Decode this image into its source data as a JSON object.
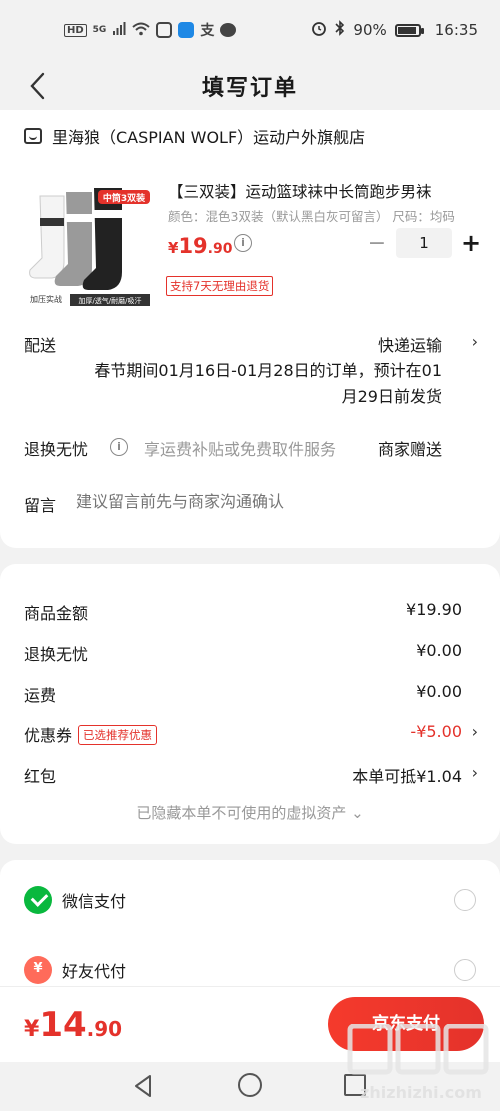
{
  "status_bar": {
    "left_icons": [
      "HD",
      "5G",
      "signal-icon",
      "wifi-icon",
      "app-icon",
      "app-icon",
      "alipay-icon",
      "chat-icon"
    ],
    "hd": "HD",
    "network": "5G",
    "battery": "90%",
    "time": "16:35"
  },
  "header": {
    "title": "填写订单"
  },
  "shop": {
    "name": "里海狼（CASPIAN WOLF）运动户外旗舰店"
  },
  "product": {
    "title": "【三双装】运动篮球袜中长筒跑步男袜",
    "spec": "颜色：混色3双装（默认黑白灰可留言）  尺码：均码",
    "price_symbol": "¥",
    "price_int": "19",
    "price_dec": ".90",
    "quantity": "1",
    "return_tag": "支持7天无理由退货",
    "image_badge": "中筒3双装",
    "image_caption": "加压实战",
    "image_caption2": "加厚/透气/耐磨/吸汗"
  },
  "delivery": {
    "label": "配送",
    "value": "快递运输",
    "note": "春节期间01月16日-01月28日的订单，预计在01月29日前发货"
  },
  "return_service": {
    "label": "退换无忧",
    "desc": "享运费补贴或免费取件服务",
    "value": "商家赠送"
  },
  "remark": {
    "label": "留言",
    "placeholder": "建议留言前先与商家沟通确认"
  },
  "summary": {
    "goods_label": "商品金额",
    "goods_value": "¥19.90",
    "return_label": "退换无忧",
    "return_value": "¥0.00",
    "shipping_label": "运费",
    "shipping_value": "¥0.00",
    "coupon_label": "优惠券",
    "coupon_badge": "已选推荐优惠",
    "coupon_value": "-¥5.00",
    "redpack_label": "红包",
    "redpack_value": "本单可抵¥1.04",
    "hidden_assets": "已隐藏本单不可使用的虚拟资产 ⌄"
  },
  "payment": {
    "wechat_label": "微信支付",
    "friend_label": "好友代付"
  },
  "bottom": {
    "total_symbol": "¥",
    "total_int": "14",
    "total_dec": ".90",
    "pay_button": "京东支付"
  },
  "watermark": {
    "line1": "值得买",
    "line2": "zhizhizhi.com"
  },
  "colors": {
    "accent": "#e4322b",
    "wechat": "#09b83e"
  }
}
